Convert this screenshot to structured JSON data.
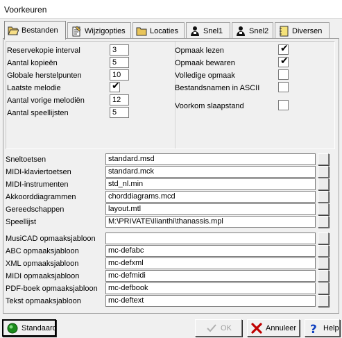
{
  "window": {
    "title": "Voorkeuren"
  },
  "tabs": [
    {
      "label": "Bestanden",
      "icon": "folder-open-icon",
      "active": true
    },
    {
      "label": "Wijzigopties",
      "icon": "notepad-icon",
      "active": false
    },
    {
      "label": "Locaties",
      "icon": "folder-icon",
      "active": false
    },
    {
      "label": "Snel1",
      "icon": "quick-access-person-icon",
      "active": false
    },
    {
      "label": "Snel2",
      "icon": "quick-access-person-icon",
      "active": false
    },
    {
      "label": "Diversen",
      "icon": "notebook-icon",
      "active": false
    }
  ],
  "left_settings": [
    {
      "label": "Reservekopie interval",
      "value": "3",
      "type": "number"
    },
    {
      "label": "Aantal kopieën",
      "value": "5",
      "type": "number"
    },
    {
      "label": "Globale herstelpunten",
      "value": "10",
      "type": "number"
    },
    {
      "label": "Laatste melodie",
      "checked": true,
      "type": "checkbox"
    },
    {
      "label": "Aantal vorige melodiën",
      "value": "12",
      "type": "number"
    },
    {
      "label": "Aantal speellijsten",
      "value": "5",
      "type": "number"
    }
  ],
  "right_settings": [
    {
      "label": "Opmaak lezen",
      "checked": true
    },
    {
      "label": "Opmaak bewaren",
      "checked": true
    },
    {
      "label": "Volledige opmaak",
      "checked": false
    },
    {
      "label": "Bestandsnamen in ASCII",
      "checked": false
    },
    {
      "label": "Voorkom slaapstand",
      "checked": false
    }
  ],
  "file_settings": [
    {
      "label": "Sneltoetsen",
      "value": "standard.msd"
    },
    {
      "label": "MIDI-klaviertoetsen",
      "value": "standard.mck"
    },
    {
      "label": "MIDI-instrumenten",
      "value": "std_nl.min"
    },
    {
      "label": "Akkoorddiagrammen",
      "value": "chorddiagrams.mcd"
    },
    {
      "label": "Gereedschappen",
      "value": "layout.mtl"
    },
    {
      "label": "Speellijst",
      "value": "M:\\PRIVATE\\Ilianthi\\thanassis.mpl"
    }
  ],
  "template_settings": [
    {
      "label": "MusiCAD opmaaksjabloon",
      "value": ""
    },
    {
      "label": "ABC opmaaksjabloon",
      "value": "mc-defabc"
    },
    {
      "label": "XML opmaaksjabloon",
      "value": "mc-defxml"
    },
    {
      "label": "MIDI opmaaksjabloon",
      "value": "mc-defmidi"
    },
    {
      "label": "PDF-boek opmaaksjabloon",
      "value": "mc-defbook"
    },
    {
      "label": "Tekst opmaaksjabloon",
      "value": "mc-deftext"
    }
  ],
  "buttons": {
    "standard": "Standaard",
    "ok": "OK",
    "cancel": "Annuleer",
    "help": "Help"
  },
  "colors": {
    "standard_icon": "#1a8a1a",
    "cancel_icon": "#c00000",
    "help_icon": "#1040c0"
  }
}
